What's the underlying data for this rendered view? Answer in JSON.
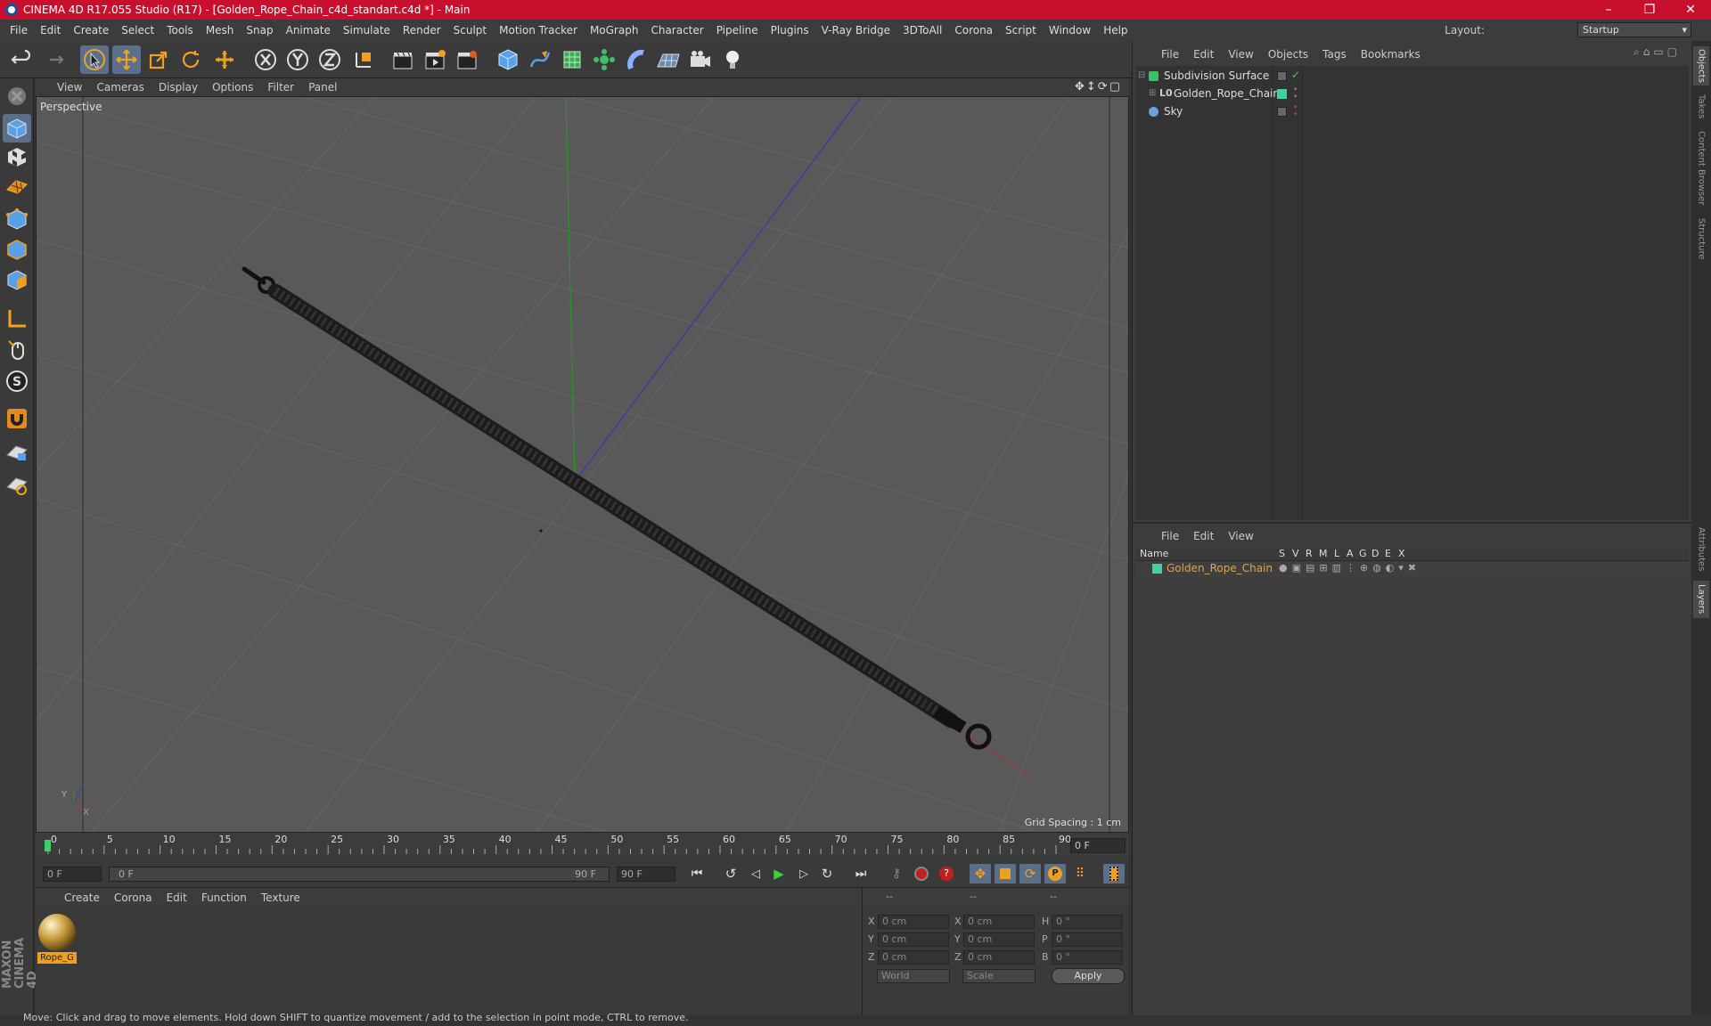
{
  "window": {
    "title": "CINEMA 4D R17.055 Studio (R17) - [Golden_Rope_Chain_c4d_standart.c4d *] - Main",
    "controls": [
      "–",
      "❐",
      "✕"
    ]
  },
  "menubar": {
    "items": [
      "File",
      "Edit",
      "Create",
      "Select",
      "Tools",
      "Mesh",
      "Snap",
      "Animate",
      "Simulate",
      "Render",
      "Sculpt",
      "Motion Tracker",
      "MoGraph",
      "Character",
      "Pipeline",
      "Plugins",
      "V-Ray Bridge",
      "3DToAll",
      "Corona",
      "Script",
      "Window",
      "Help"
    ],
    "layout_label": "Layout:",
    "layout_value": "Startup"
  },
  "viewport": {
    "menu": [
      "View",
      "Cameras",
      "Display",
      "Options",
      "Filter",
      "Panel"
    ],
    "camera_label": "Perspective",
    "grid_spacing": "Grid Spacing : 1 cm"
  },
  "timeline": {
    "ticks": [
      "0",
      "5",
      "10",
      "15",
      "20",
      "25",
      "30",
      "35",
      "40",
      "45",
      "50",
      "55",
      "60",
      "65",
      "70",
      "75",
      "80",
      "85",
      "90"
    ],
    "current_frame": "0 F",
    "start_frame": "0 F",
    "range_start": "0 F",
    "range_end": "90 F",
    "end_frame": "90 F"
  },
  "material_panel": {
    "menu": [
      "Create",
      "Corona",
      "Edit",
      "Function",
      "Texture"
    ],
    "material_name": "Rope_G"
  },
  "coord_panel": {
    "header": [
      "--",
      "--",
      "--"
    ],
    "rows": [
      {
        "a": "X",
        "av": "0 cm",
        "b": "X",
        "bv": "0 cm",
        "c": "H",
        "cv": "0 °"
      },
      {
        "a": "Y",
        "av": "0 cm",
        "b": "Y",
        "bv": "0 cm",
        "c": "P",
        "cv": "0 °"
      },
      {
        "a": "Z",
        "av": "0 cm",
        "b": "Z",
        "bv": "0 cm",
        "c": "B",
        "cv": "0 °"
      }
    ],
    "space": "World",
    "mode": "Scale",
    "apply": "Apply"
  },
  "object_manager": {
    "menu": [
      "File",
      "Edit",
      "View",
      "Objects",
      "Tags",
      "Bookmarks"
    ],
    "objects": [
      {
        "name": "Subdivision Surface",
        "tag_color": "#3fbf6a"
      },
      {
        "name": "Golden_Rope_Chain",
        "tag_color": "#3fd49a"
      },
      {
        "name": "Sky",
        "tag_color": "#6fa0d8"
      }
    ]
  },
  "layer_manager": {
    "menu": [
      "File",
      "Edit",
      "View"
    ],
    "columns": [
      "Name",
      "S",
      "V",
      "R",
      "M",
      "L",
      "A",
      "G",
      "D",
      "E",
      "X"
    ],
    "layer_name": "Golden_Rope_Chain",
    "layer_color": "#e8a33a"
  },
  "side_tabs": [
    "Objects",
    "Takes",
    "Content Browser",
    "Structure",
    "Attributes",
    "Layers"
  ],
  "branding": {
    "maxon_logo": "MAXON CINEMA 4D"
  },
  "status": {
    "text": "Move: Click and drag to move elements. Hold down SHIFT to quantize movement / add to the selection in point mode, CTRL to remove."
  },
  "colors": {
    "title_bar": "#c8102e",
    "accent_orange": "#f0a020",
    "active_tool": "#5a6f8a"
  }
}
